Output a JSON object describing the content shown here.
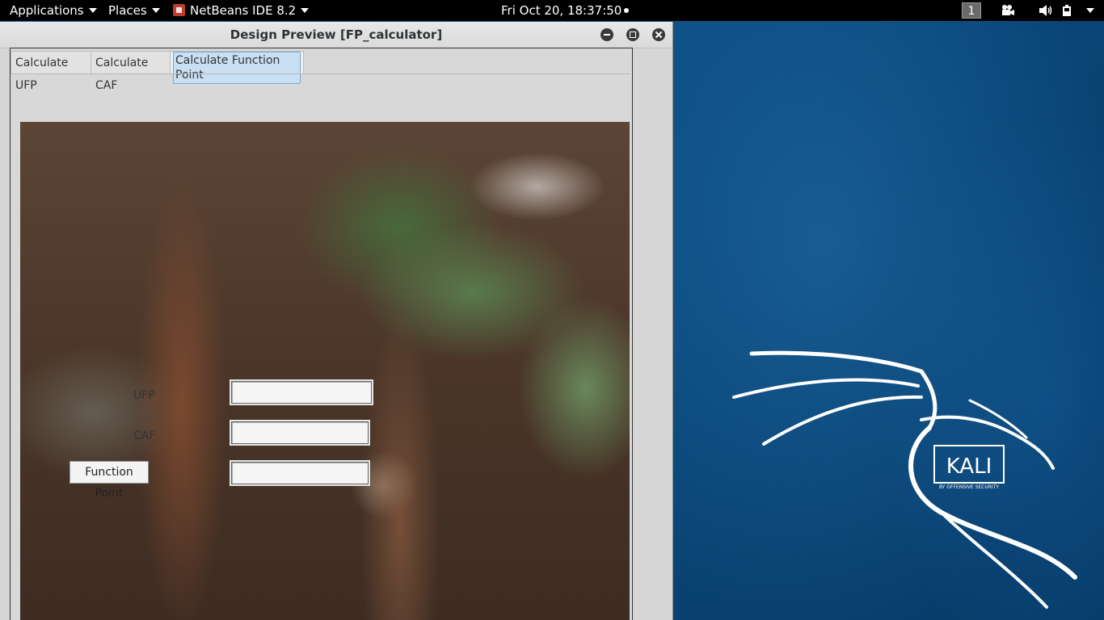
{
  "top_panel": {
    "applications_label": "Applications",
    "places_label": "Places",
    "app_label": "NetBeans IDE 8.2",
    "clock": "Fri Oct 20, 18:37:50",
    "workspace": "1"
  },
  "window": {
    "title": "Design Preview [FP_calculator]",
    "tabs": [
      {
        "label": "Calculate UFP"
      },
      {
        "label": "Calculate CAF"
      },
      {
        "label": "Calculate Function Point"
      }
    ],
    "active_tab": "Calculate Function Point",
    "form": {
      "ufp_label": "UFP",
      "ufp_value": "",
      "caf_label": "CAF",
      "caf_value": "",
      "function_point_button": "Function Point",
      "function_point_value": ""
    }
  },
  "wallpaper": {
    "logo_text": "KALI",
    "logo_subtext": "BY OFFENSIVE SECURITY"
  },
  "colors": {
    "wallpaper": "#0b4a7e",
    "panel": "#000000",
    "tab_highlight": "#c9dff3"
  },
  "icons": [
    "netbeans-icon",
    "camera-icon",
    "volume-icon",
    "battery-icon",
    "minimize-icon",
    "maximize-icon",
    "close-icon"
  ]
}
